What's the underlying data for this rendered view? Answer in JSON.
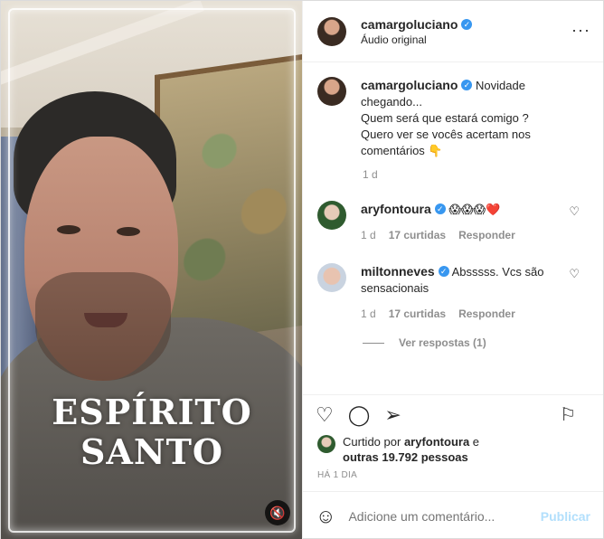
{
  "post": {
    "author": "camargoluciano",
    "audio": "Áudio original",
    "more_icon": "more-dots-icon",
    "media": {
      "overlay_line1": "ESPÍRITO",
      "overlay_line2": "SANTO",
      "mute_icon": "volume-mute-icon"
    },
    "caption": {
      "username": "camargoluciano",
      "lines": [
        "Novidade",
        "chegando...",
        "Quem será que estará comigo ?",
        "Quero ver se vocês acertam nos",
        "comentários 👇"
      ],
      "time": "1 d"
    },
    "comments": [
      {
        "username": "aryfontoura",
        "text": "😱😱😱❤️",
        "time": "1 d",
        "likes": "17 curtidas",
        "reply": "Responder"
      },
      {
        "username": "miltonneves",
        "text": "Absssss. Vcs são sensacionais",
        "time": "1 d",
        "likes": "17 curtidas",
        "reply": "Responder"
      }
    ],
    "view_replies": "Ver respostas (1)",
    "liked_by": {
      "prefix": "Curtido por",
      "user": "aryfontoura",
      "suffix": "e",
      "others": "outras 19.792 pessoas"
    },
    "date": "HÁ 1 DIA",
    "add_comment_placeholder": "Adicione um comentário...",
    "publish_label": "Publicar",
    "colors": {
      "link_blue": "#3897f0",
      "publish_disabled": "#b2dffc",
      "muted_text": "#8e8e8e"
    }
  }
}
